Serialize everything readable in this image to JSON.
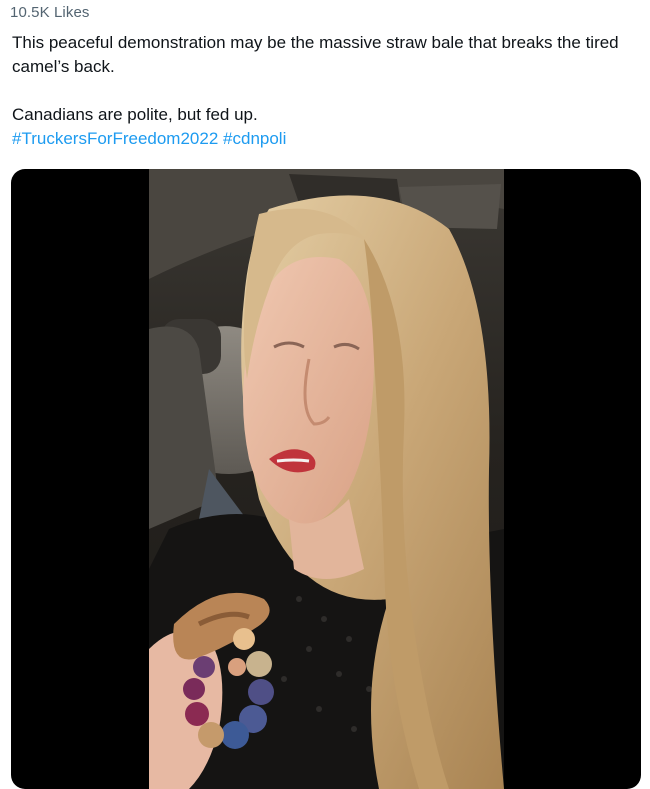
{
  "tweet": {
    "likes": "10.5K Likes",
    "text_line1": "This peaceful demonstration may be the massive straw bale that breaks the tired camel’s back.",
    "text_line2": "Canadians are polite, but fed up.",
    "hashtags": [
      "#TruckersForFreedom2022",
      "#cdnpoli"
    ]
  },
  "media": {
    "type": "video",
    "subject": "woman-with-blonde-hair-in-car-holding-teething-ring"
  },
  "colors": {
    "link": "#1d9bf0",
    "text": "#0f1419",
    "muted": "#536471",
    "media_background": "#000000"
  }
}
